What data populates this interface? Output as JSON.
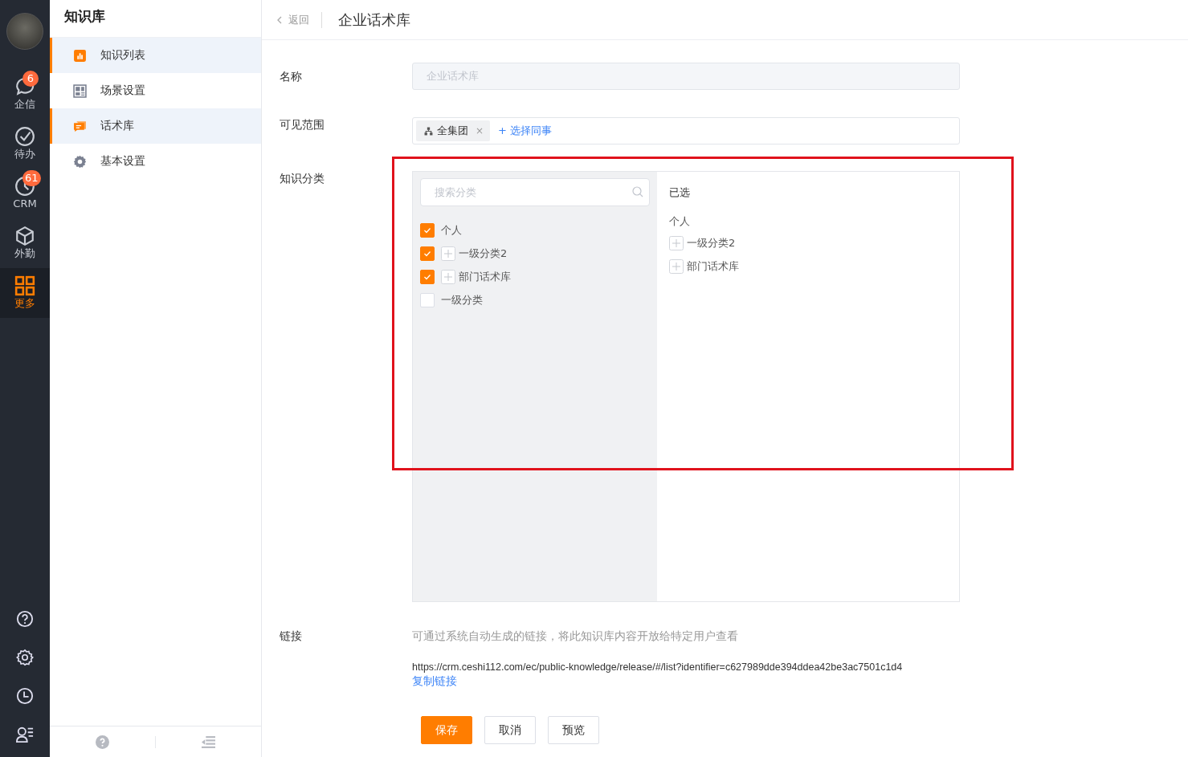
{
  "rail": {
    "items": [
      {
        "label": "企信",
        "kind": "chat",
        "badge": "6",
        "selected": false
      },
      {
        "label": "待办",
        "kind": "check",
        "selected": false
      },
      {
        "label": "CRM",
        "kind": "clock",
        "badge": "61",
        "selected": false
      },
      {
        "label": "外勤",
        "kind": "box",
        "selected": false
      },
      {
        "label": "更多",
        "kind": "grid",
        "selected": true
      }
    ]
  },
  "sidebar": {
    "title": "知识库",
    "items": [
      {
        "label": "知识列表",
        "kind": "chart",
        "selected": true
      },
      {
        "label": "场景设置",
        "kind": "layout",
        "selected": false
      },
      {
        "label": "话术库",
        "kind": "message",
        "selected": true
      },
      {
        "label": "基本设置",
        "kind": "gear",
        "selected": false
      }
    ]
  },
  "header": {
    "back": "返回",
    "title": "企业话术库"
  },
  "form": {
    "name": {
      "label": "名称",
      "value": "企业话术库",
      "disabled": true
    },
    "visibility": {
      "label": "可见范围",
      "tags": [
        {
          "text": "全集团",
          "remove": "×"
        }
      ],
      "add_link": "+ 选择同事"
    },
    "category": {
      "label": "知识分类",
      "search_placeholder": "搜索分类",
      "tree": [
        {
          "label": "个人",
          "checked": true,
          "expandable": false
        },
        {
          "label": "一级分类2",
          "checked": true,
          "expandable": true
        },
        {
          "label": "部门话术库",
          "checked": true,
          "expandable": true
        },
        {
          "label": "一级分类",
          "checked": false,
          "expandable": false
        }
      ],
      "selected_title": "已选",
      "selected_group": "个人",
      "selected_items": [
        {
          "label": "一级分类2",
          "expandable": true
        },
        {
          "label": "部门话术库",
          "expandable": true
        }
      ]
    },
    "link": {
      "label": "链接",
      "description": "可通过系统自动生成的链接，将此知识库内容开放给特定用户查看",
      "url": "https://crm.ceshi112.com/ec/public-knowledge/release/#/list?identifier=c627989dde394ddea42be3ac7501c1d4",
      "copy_link": "复制链接"
    },
    "buttons": [
      {
        "label": "保存",
        "kind": "primary"
      },
      {
        "label": "取消",
        "kind": "default"
      },
      {
        "label": "预览",
        "kind": "default"
      }
    ]
  }
}
